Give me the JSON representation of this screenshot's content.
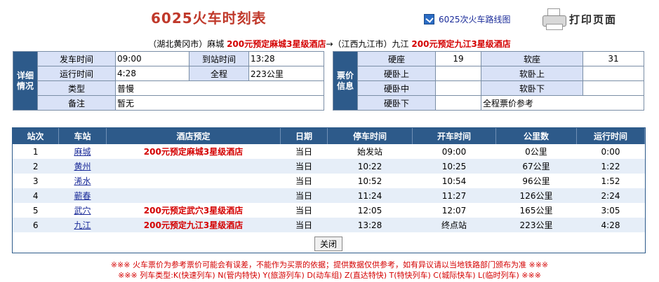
{
  "title": "6025火车时刻表",
  "map_link": "6025次火车路线图",
  "print_label": "打印页面",
  "route": {
    "from_region": "（湖北黄冈市）",
    "from_city": "麻城",
    "from_hotel": "200元预定麻城3星级酒店",
    "arrow": "→",
    "to_region": "（江西九江市）",
    "to_city": "九江",
    "to_hotel": "200元预定九江3星级酒店"
  },
  "detail": {
    "heading": "详细情况",
    "depart_label": "发车时间",
    "depart_value": "09:00",
    "arrive_label": "到站时间",
    "arrive_value": "13:28",
    "run_label": "运行时间",
    "run_value": "4:28",
    "distance_label": "全程",
    "distance_value": "223公里",
    "type_label": "类型",
    "type_value": "普慢",
    "remark_label": "备注",
    "remark_value": "暂无"
  },
  "ticket": {
    "heading": "票价信息",
    "hard_seat_label": "硬座",
    "hard_seat_value": "19",
    "soft_seat_label": "软座",
    "soft_seat_value": "31",
    "hard_sleeper_up": "硬卧上",
    "soft_sleeper_up": "软卧上",
    "hard_sleeper_mid": "硬卧中",
    "soft_sleeper_down": "软卧下",
    "hard_sleeper_down": "硬卧下",
    "ref_note": "全程票价参考"
  },
  "schedule": {
    "headers": [
      "站次",
      "车站",
      "酒店预定",
      "日期",
      "停车时间",
      "开车时间",
      "公里数",
      "运行时间"
    ],
    "rows": [
      {
        "no": "1",
        "station": "麻城",
        "hotel": "200元预定麻城3星级酒店",
        "date": "当日",
        "arrive": "始发站",
        "depart": "09:00",
        "km": "0公里",
        "run": "0:00"
      },
      {
        "no": "2",
        "station": "黄州",
        "hotel": "",
        "date": "当日",
        "arrive": "10:22",
        "depart": "10:25",
        "km": "67公里",
        "run": "1:22"
      },
      {
        "no": "3",
        "station": "浠水",
        "hotel": "",
        "date": "当日",
        "arrive": "10:52",
        "depart": "10:54",
        "km": "96公里",
        "run": "1:52"
      },
      {
        "no": "4",
        "station": "蕲春",
        "hotel": "",
        "date": "当日",
        "arrive": "11:24",
        "depart": "11:27",
        "km": "126公里",
        "run": "2:24"
      },
      {
        "no": "5",
        "station": "武穴",
        "hotel": "200元预定武穴3星级酒店",
        "date": "当日",
        "arrive": "12:05",
        "depart": "12:07",
        "km": "165公里",
        "run": "3:05"
      },
      {
        "no": "6",
        "station": "九江",
        "hotel": "200元预定九江3星级酒店",
        "date": "当日",
        "arrive": "13:28",
        "depart": "终点站",
        "km": "223公里",
        "run": "4:28"
      }
    ]
  },
  "close_label": "关闭",
  "note1": "※※※ 火车票价为参考票价可能会有误差，不能作为买票的依据；提供数据仅供参考，如有异议请以当地铁路部门颁布为准 ※※※",
  "note2": "※※※ 列车类型:K(快速列车) N(管内特快) Y(旅游列车) D(动车组) Z(直达特快) T(特快列车) C(城际快车) L(临时列车) ※※※"
}
